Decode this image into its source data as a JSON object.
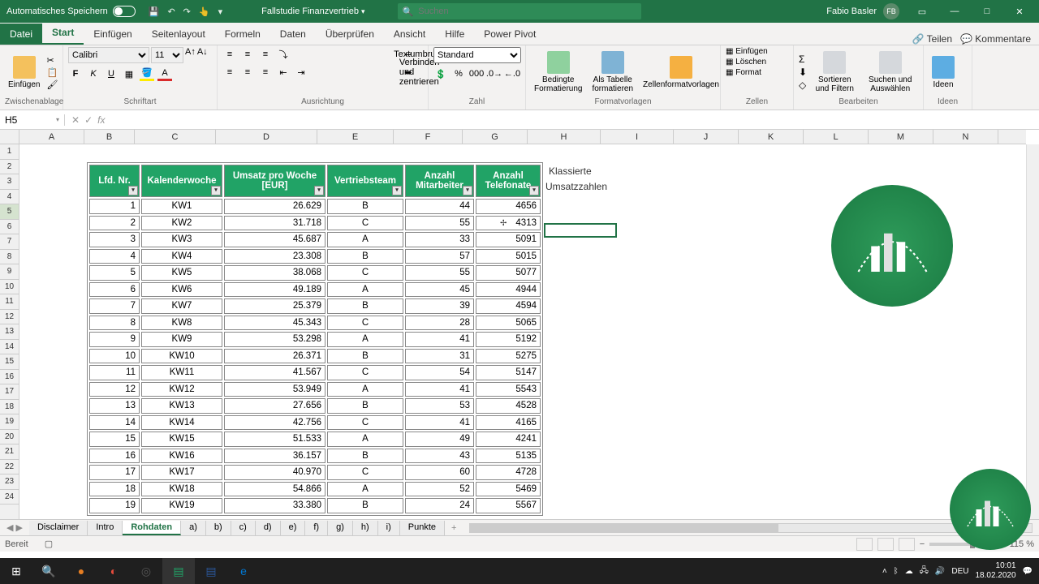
{
  "titlebar": {
    "autosave": "Automatisches Speichern",
    "filename": "Fallstudie Finanzvertrieb",
    "search_placeholder": "Suchen",
    "username": "Fabio Basler",
    "initials": "FB"
  },
  "tabs": {
    "datei": "Datei",
    "start": "Start",
    "einfuegen": "Einfügen",
    "seitenlayout": "Seitenlayout",
    "formeln": "Formeln",
    "daten": "Daten",
    "ueberpruefen": "Überprüfen",
    "ansicht": "Ansicht",
    "hilfe": "Hilfe",
    "powerpivot": "Power Pivot",
    "teilen": "Teilen",
    "kommentare": "Kommentare"
  },
  "ribbon": {
    "einfuegen": "Einfügen",
    "zwischenablage": "Zwischenablage",
    "font_name": "Calibri",
    "font_size": "11",
    "schriftart": "Schriftart",
    "textumbruch": "Textumbruch",
    "verbinden": "Verbinden und zentrieren",
    "ausrichtung": "Ausrichtung",
    "format_sel": "Standard",
    "zahl": "Zahl",
    "bedingte": "Bedingte Formatierung",
    "alstabelle": "Als Tabelle formatieren",
    "zellenformat": "Zellenformatvorlagen",
    "formatvorlagen": "Formatvorlagen",
    "cells_insert": "Einfügen",
    "cells_delete": "Löschen",
    "cells_format": "Format",
    "zellen": "Zellen",
    "sortfilter": "Sortieren und Filtern",
    "suchen": "Suchen und Auswählen",
    "bearbeiten": "Bearbeiten",
    "ideen": "Ideen"
  },
  "namebox": "H5",
  "columns": [
    "A",
    "B",
    "C",
    "D",
    "E",
    "F",
    "G",
    "H",
    "I",
    "J",
    "K",
    "L",
    "M",
    "N"
  ],
  "headers": [
    "Lfd. Nr.",
    "Kalenderwoche",
    "Umsatz pro Woche [EUR]",
    "Vertriebsteam",
    "Anzahl Mitarbeiter",
    "Anzahl Telefonate"
  ],
  "rows": [
    [
      1,
      "KW1",
      "26.629",
      "B",
      44,
      4656
    ],
    [
      2,
      "KW2",
      "31.718",
      "C",
      55,
      4313
    ],
    [
      3,
      "KW3",
      "45.687",
      "A",
      33,
      5091
    ],
    [
      4,
      "KW4",
      "23.308",
      "B",
      57,
      5015
    ],
    [
      5,
      "KW5",
      "38.068",
      "C",
      55,
      5077
    ],
    [
      6,
      "KW6",
      "49.189",
      "A",
      45,
      4944
    ],
    [
      7,
      "KW7",
      "25.379",
      "B",
      39,
      4594
    ],
    [
      8,
      "KW8",
      "45.343",
      "C",
      28,
      5065
    ],
    [
      9,
      "KW9",
      "53.298",
      "A",
      41,
      5192
    ],
    [
      10,
      "KW10",
      "26.371",
      "B",
      31,
      5275
    ],
    [
      11,
      "KW11",
      "41.567",
      "C",
      54,
      5147
    ],
    [
      12,
      "KW12",
      "53.949",
      "A",
      41,
      5543
    ],
    [
      13,
      "KW13",
      "27.656",
      "B",
      53,
      4528
    ],
    [
      14,
      "KW14",
      "42.756",
      "C",
      41,
      4165
    ],
    [
      15,
      "KW15",
      "51.533",
      "A",
      49,
      4241
    ],
    [
      16,
      "KW16",
      "36.157",
      "B",
      43,
      5135
    ],
    [
      17,
      "KW17",
      "40.970",
      "C",
      60,
      4728
    ],
    [
      18,
      "KW18",
      "54.866",
      "A",
      52,
      5469
    ],
    [
      19,
      "KW19",
      "33.380",
      "B",
      24,
      5567
    ]
  ],
  "freetext": {
    "h2": "Klassierte",
    "h3": "Umsatzzahlen"
  },
  "sheets": {
    "list": [
      "Disclaimer",
      "Intro",
      "Rohdaten",
      "a)",
      "b)",
      "c)",
      "d)",
      "e)",
      "f)",
      "g)",
      "h)",
      "i)",
      "Punkte"
    ],
    "active": "Rohdaten",
    "add": "+"
  },
  "statusbar": {
    "ready": "Bereit",
    "zoom": "115 %"
  },
  "taskbar": {
    "lang": "DEU",
    "time": "10:01",
    "date": "18.02.2020"
  }
}
